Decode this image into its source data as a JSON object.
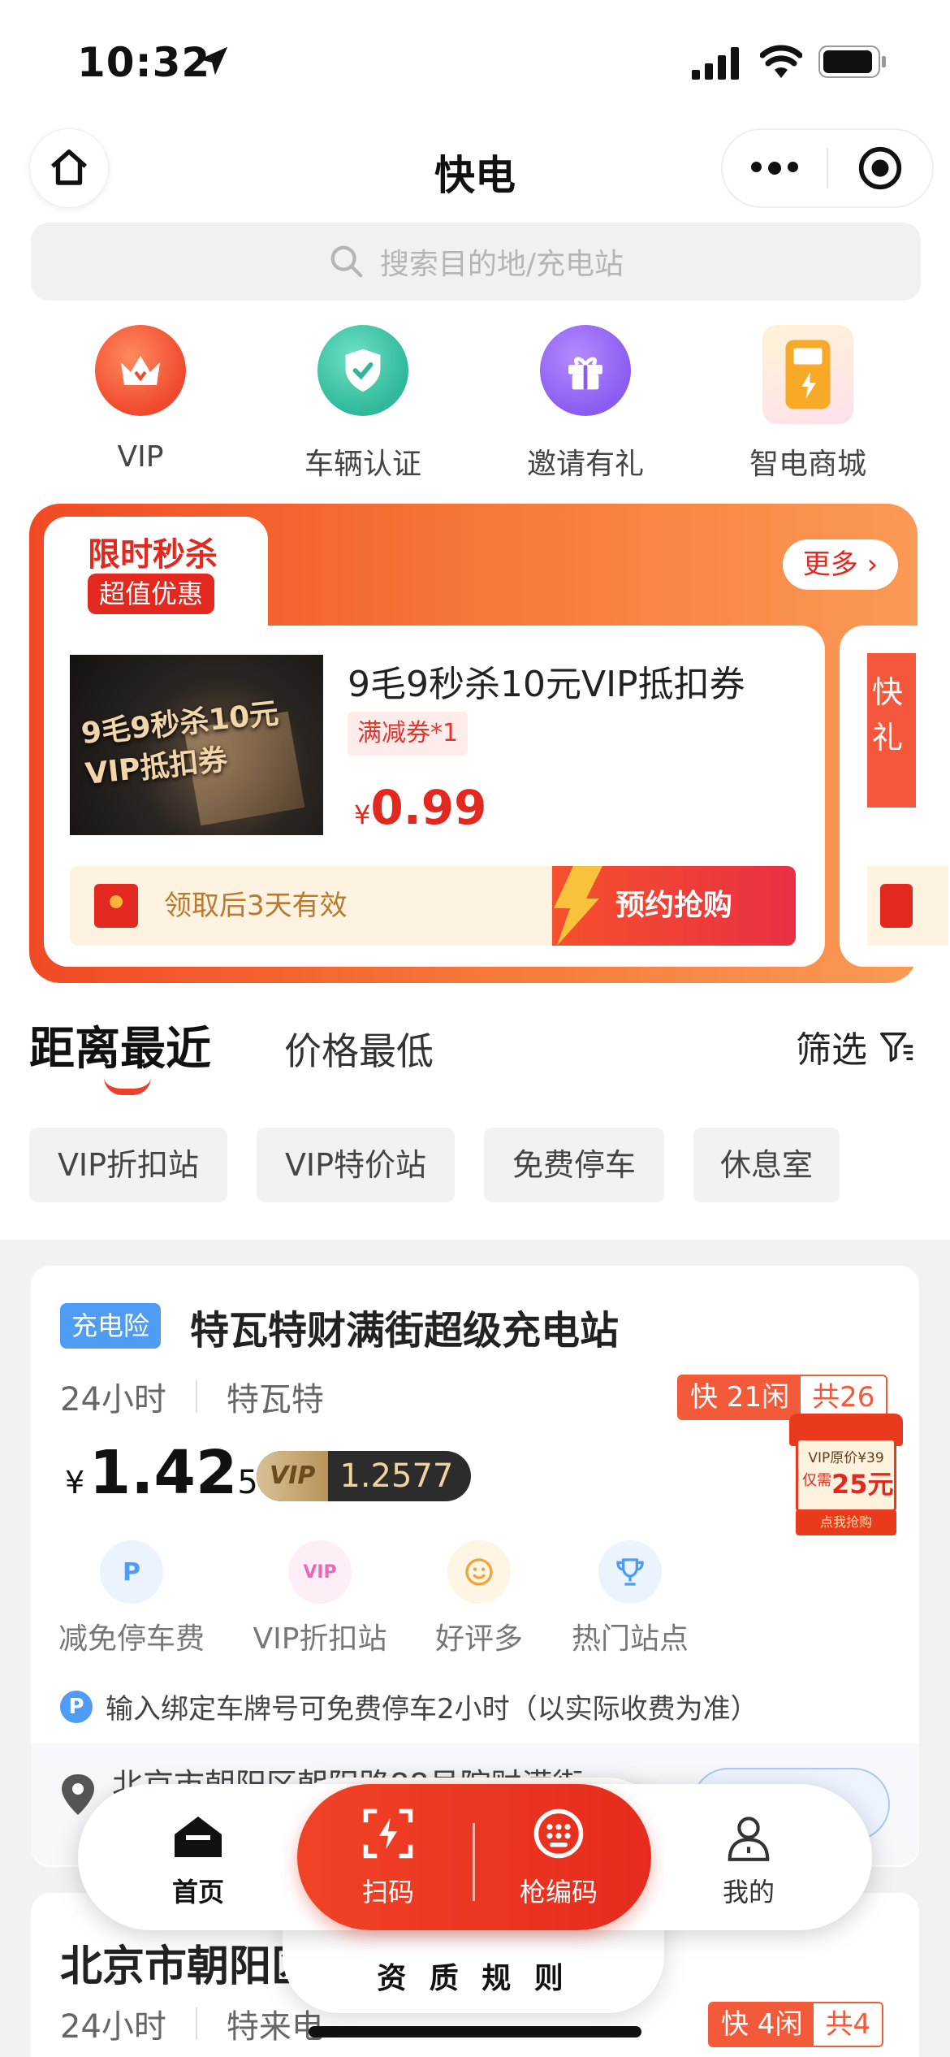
{
  "status_bar": {
    "time": "10:32"
  },
  "nav": {
    "title": "快电"
  },
  "search": {
    "placeholder": "搜索目的地/充电站"
  },
  "quick_links": [
    {
      "label": "VIP",
      "icon": "crown-icon",
      "color": "#f0492e"
    },
    {
      "label": "车辆认证",
      "icon": "shield-check-icon",
      "color": "#2fb89a"
    },
    {
      "label": "邀请有礼",
      "icon": "gift-icon",
      "color": "#8a5cf0"
    },
    {
      "label": "智电商城",
      "icon": "charger-icon",
      "color": "#f7a928"
    }
  ],
  "promo": {
    "tab_title": "限时秒杀",
    "tab_badge": "超值优惠",
    "more": "更多",
    "image_text": "9毛9秒杀10元VIP抵扣券",
    "product_title": "9毛9秒杀10元VIP抵扣券",
    "tag": "满减券*1",
    "currency": "¥",
    "price": "0.99",
    "validity": "领取后3天有效",
    "buy_button": "预约抢购",
    "peek_text": "快礼"
  },
  "sort_tabs": {
    "nearest": "距离最近",
    "cheapest": "价格最低",
    "filter": "筛选"
  },
  "chips": [
    "VIP折扣站",
    "VIP特价站",
    "免费停车",
    "休息室"
  ],
  "station1": {
    "badge": "充电险",
    "name": "特瓦特财满街超级充电站",
    "hours": "24小时",
    "operator": "特瓦特",
    "avail_fast": "快 21闲",
    "avail_total": "共26",
    "currency": "¥",
    "price_main": "1.42",
    "price_tail": "57",
    "vip_label": "VIP",
    "vip_price": "1.2577",
    "gift_top": "VIP原价¥39",
    "gift_price": "25元",
    "gift_prefix": "仅需",
    "gift_btn": "点我抢购",
    "features": [
      {
        "label": "减免停车费",
        "icon": "parking-icon",
        "color": "#4f9cf4"
      },
      {
        "label": "VIP折扣站",
        "icon": "vip-icon",
        "color": "#e66ab4"
      },
      {
        "label": "好评多",
        "icon": "smile-icon",
        "color": "#f2a33a"
      },
      {
        "label": "热门站点",
        "icon": "trophy-icon",
        "color": "#4f9cf4"
      }
    ],
    "parking_note": "输入绑定车牌号可免费停车2小时（以实际收费为准）",
    "address": "北京市朝阳区朝阳路88号院财满街"
  },
  "station2": {
    "name": "北京市朝阳区",
    "hours": "24小时",
    "operator": "特来电",
    "avail_fast": "快 4闲",
    "avail_total": "共4"
  },
  "tabbar": {
    "home": "首页",
    "scan": "扫码",
    "code": "枪编码",
    "mine": "我的",
    "rules": "资 质 规 则"
  }
}
